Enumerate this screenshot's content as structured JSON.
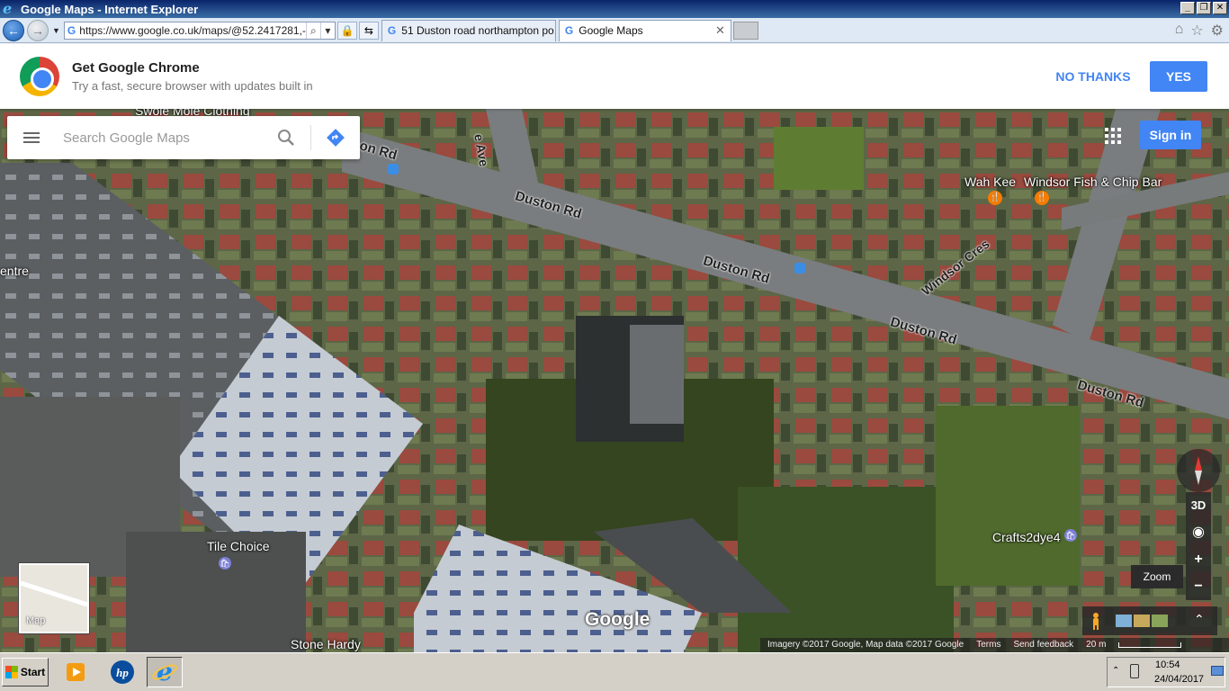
{
  "window": {
    "title": "Google Maps - Internet Explorer",
    "address_url": "https://www.google.co.uk/maps/@52.2417281,-0.",
    "tabs": [
      {
        "label": "51 Duston road northampton po..."
      },
      {
        "label": "Google Maps"
      }
    ]
  },
  "banner": {
    "title": "Get Google Chrome",
    "subtitle": "Try a fast, secure browser with updates built in",
    "no_thanks": "NO THANKS",
    "yes": "YES"
  },
  "map": {
    "search_placeholder": "Search Google Maps",
    "sign_in": "Sign in",
    "place_labels": {
      "swole": "Swole Mole Clothing",
      "wah_kee": "Wah Kee",
      "windsor_fish": "Windsor Fish & Chip Bar",
      "centre": "entre",
      "tile_choice": "Tile Choice",
      "crafts2dye4": "Crafts2dye4",
      "stone_hardy": "Stone Hardy"
    },
    "road_labels": {
      "duston1": "Duston Rd",
      "duston2": "Duston Rd",
      "duston3": "Duston Rd",
      "duston4": "Duston Rd",
      "duston_top": "on Rd",
      "windsor": "Windsor Cres",
      "ave": "e Ave"
    },
    "minimap_label": "Map",
    "controls": {
      "three_d": "3D",
      "zoom_in": "+",
      "zoom_out": "−",
      "zoom_tooltip": "Zoom"
    },
    "google_logo": "Google",
    "attribution": {
      "imagery": "Imagery ©2017 Google, Map data ©2017 Google",
      "terms": "Terms",
      "feedback": "Send feedback",
      "scale": "20 m"
    }
  },
  "taskbar": {
    "start": "Start",
    "time": "10:54",
    "date": "24/04/2017"
  }
}
